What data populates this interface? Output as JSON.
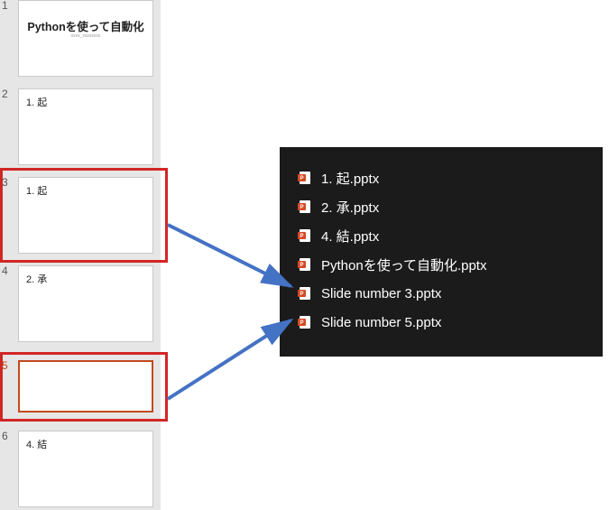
{
  "slides": [
    {
      "num": "1",
      "title": "Pythonを使って自動化",
      "subtitle": "xxxx_xxxxxxxx",
      "centered": true
    },
    {
      "num": "2",
      "title": "1. 起"
    },
    {
      "num": "3",
      "title": "1. 起"
    },
    {
      "num": "4",
      "title": "2. 承"
    },
    {
      "num": "5",
      "title": ""
    },
    {
      "num": "6",
      "title": "4. 結"
    }
  ],
  "files": [
    {
      "name": "1. 起.pptx"
    },
    {
      "name": "2. 承.pptx"
    },
    {
      "name": "4. 結.pptx"
    },
    {
      "name": "Pythonを使って自動化.pptx"
    },
    {
      "name": "Slide number 3.pptx"
    },
    {
      "name": "Slide number 5.pptx"
    }
  ],
  "diagram": {
    "highlighted_slides": [
      3,
      5
    ],
    "arrows": [
      {
        "from_slide": 3,
        "to_file": "Slide number 3.pptx"
      },
      {
        "from_slide": 5,
        "to_file": "Slide number 5.pptx"
      }
    ]
  }
}
